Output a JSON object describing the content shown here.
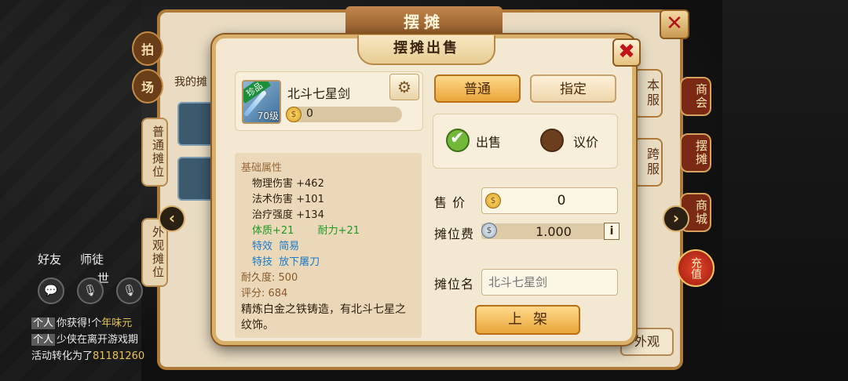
{
  "background": {
    "title": "摆摊",
    "left_tabs": [
      "拍",
      "场"
    ],
    "vertical_tabs": [
      "普通摊位",
      "外观摊位"
    ],
    "sub_header": "我的摊",
    "server_tabs": [
      "本服",
      "跨服"
    ],
    "side_menu": [
      "商会",
      "摆摊",
      "商城"
    ],
    "recharge": "充值",
    "hud": {
      "friend": "好友",
      "mentor": "师徒",
      "shi": "世",
      "chat_icon": "💬"
    },
    "chat": [
      {
        "tag": "个人",
        "text": "你获得!个",
        "highlight": "年味元"
      },
      {
        "tag": "个人",
        "text": "少侠在离开游戏期",
        "highlight": ""
      },
      {
        "tag": "",
        "text": "活动转化为了",
        "highlight": "81181260"
      }
    ],
    "bottom_button": "外观"
  },
  "modal": {
    "title": "摆摊出售",
    "close_icon": "✖",
    "item": {
      "name": "北斗七星剑",
      "rarity_tag": "珍品",
      "level": "70级",
      "price": "0"
    },
    "attributes": {
      "header": "基础属性",
      "base": [
        "物理伤害 +462",
        "法术伤害 +101",
        "治疗强度 +134"
      ],
      "bonus_1": "体质+21",
      "bonus_2": "耐力+21",
      "effect_label": "特效",
      "effect_value": "简易",
      "skill_label": "特技",
      "skill_value": "放下屠刀",
      "durability": "耐久度: 500",
      "score": "评分: 684",
      "description": "精炼白金之铁铸造，有北斗七星之纹饰。"
    },
    "tabs": {
      "normal": "普通",
      "target": "指定"
    },
    "mode": {
      "sell": "出售",
      "negotiate": "议价",
      "selected": "出售"
    },
    "form": {
      "price_label": "售 价",
      "price_value": "0",
      "fee_label": "摊位费",
      "fee_value": "1.000",
      "info_icon": "i",
      "stall_name_label": "摊位名",
      "stall_name_placeholder": "北斗七星剑"
    },
    "list_button": "上架"
  },
  "colors": {
    "accent_gold": "#e8a53a",
    "panel_bg": "#f3e9d3",
    "close_red": "#c3141a",
    "bonus_green": "#1c9a22",
    "effect_blue": "#1a7ac9"
  }
}
